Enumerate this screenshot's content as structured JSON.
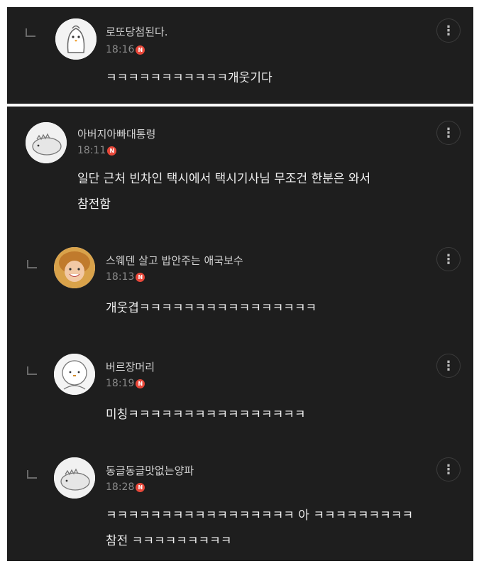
{
  "comments": [
    {
      "nick": "로또당첨된다.",
      "time": "18:16",
      "lines": [
        "ㅋㅋㅋㅋㅋㅋㅋㅋㅋㅋㅋ개웃기다"
      ]
    },
    {
      "nick": "아버지아빠대통령",
      "time": "18:11",
      "lines": [
        "일단 근처 빈차인 택시에서 택시기사님 무조건 한분은 와서",
        "참전함"
      ]
    },
    {
      "nick": "스웨덴 살고 밥안주는 애국보수",
      "time": "18:13",
      "lines": [
        "개웃겹ㅋㅋㅋㅋㅋㅋㅋㅋㅋㅋㅋㅋㅋㅋㅋㅋ"
      ]
    },
    {
      "nick": "버르장머리",
      "time": "18:19",
      "lines": [
        "미칭ㅋㅋㅋㅋㅋㅋㅋㅋㅋㅋㅋㅋㅋㅋㅋㅋ"
      ]
    },
    {
      "nick": "동글동글맛없는양파",
      "time": "18:28",
      "lines": [
        "ㅋㅋㅋㅋㅋㅋㅋㅋㅋㅋㅋㅋㅋㅋㅋㅋㅋ 아 ㅋㅋㅋㅋㅋㅋㅋㅋㅋ",
        "참전 ㅋㅋㅋㅋㅋㅋㅋㅋㅋ"
      ]
    }
  ],
  "badge_label": "N",
  "more_icon": "⋮",
  "colors": {
    "panel_bg": "#1e1e1e",
    "badge": "#e8483a",
    "nick": "#d2d2d2",
    "time": "#8a8a8a",
    "text": "#eeeeee"
  }
}
